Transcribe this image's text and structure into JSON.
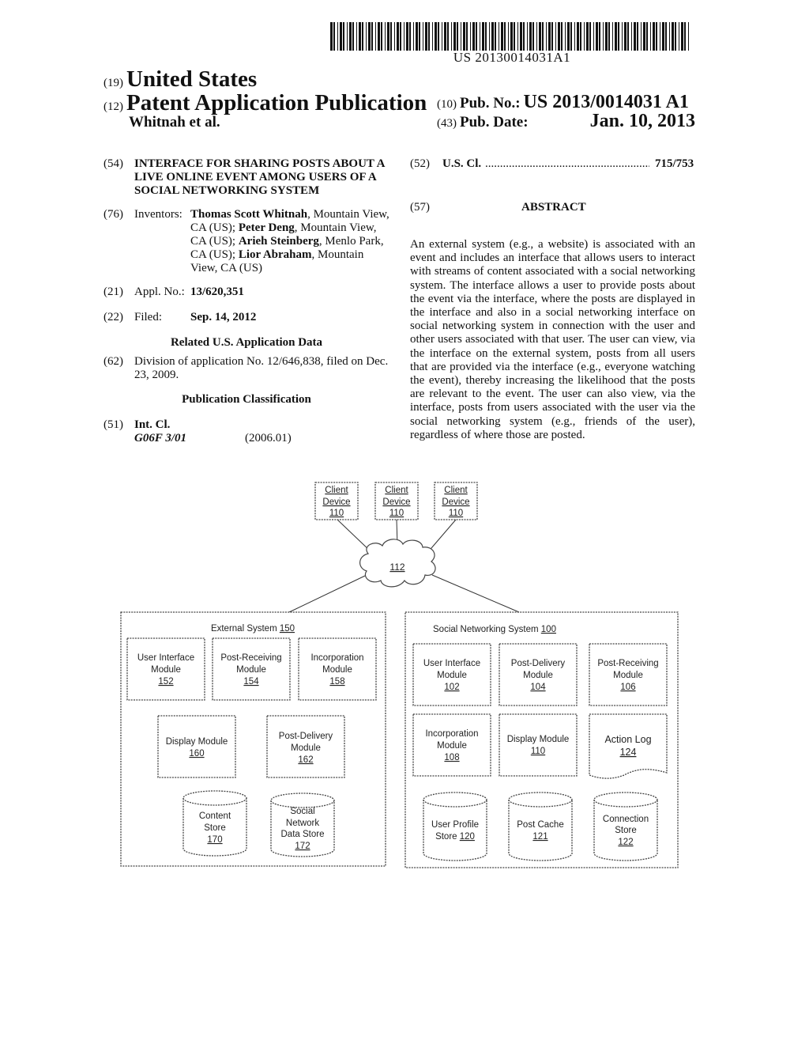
{
  "barcode": {
    "number": "US 20130014031A1"
  },
  "header": {
    "country_code": "(19)",
    "country": "United States",
    "type_code": "(12)",
    "type": "Patent Application Publication",
    "authors": "Whitnah et al.",
    "pub_no_code": "(10)",
    "pub_no_label": "Pub. No.:",
    "pub_no": "US 2013/0014031 A1",
    "pub_date_code": "(43)",
    "pub_date_label": "Pub. Date:",
    "pub_date": "Jan. 10, 2013"
  },
  "left": {
    "title_code": "(54)",
    "title_lines": [
      "INTERFACE FOR SHARING POSTS ABOUT A",
      "LIVE ONLINE EVENT AMONG USERS OF A",
      "SOCIAL NETWORKING SYSTEM"
    ],
    "inventors_code": "(76)",
    "inventors_label": "Inventors:",
    "inventors": [
      {
        "name": "Thomas Scott Whitnah",
        "loc": ", Mountain View, CA (US); "
      },
      {
        "name": "Peter Deng",
        "loc": ", Mountain View, CA (US); "
      },
      {
        "name": "Arieh Steinberg",
        "loc": ", Menlo Park, CA (US); "
      },
      {
        "name": "Lior Abraham",
        "loc": ", Mountain View, CA (US)"
      }
    ],
    "appl_code": "(21)",
    "appl_label": "Appl. No.:",
    "appl_no": "13/620,351",
    "filed_code": "(22)",
    "filed_label": "Filed:",
    "filed_date": "Sep. 14, 2012",
    "related_heading": "Related U.S. Application Data",
    "division_code": "(62)",
    "division_line1": "Division of application No. 12/646,838, filed on Dec.",
    "division_line2": "23, 2009.",
    "classification_heading": "Publication Classification",
    "intcl_code": "(51)",
    "intcl_label": "Int. Cl.",
    "intcl_class": "G06F 3/01",
    "intcl_version": "(2006.01)"
  },
  "right": {
    "uscl_code": "(52)",
    "uscl_label": "U.S. Cl.",
    "uscl_dots": "........................................................",
    "uscl_value": "715/753",
    "abstract_code": "(57)",
    "abstract_heading": "ABSTRACT",
    "abstract_text": "An external system (e.g., a website) is associated with an event and includes an interface that allows users to interact with streams of content associated with a social networking system. The interface allows a user to provide posts about the event via the interface, where the posts are displayed in the interface and also in a social networking interface on social networking system in connection with the user and other users associated with that user. The user can view, via the interface on the external system, posts from all users that are provided via the interface (e.g., everyone watching the event), thereby increasing the likelihood that the posts are relevant to the event. The user can also view, via the interface, posts from users associated with the user via the social networking sys­tem (e.g., friends of the user), regardless of where those are posted."
  },
  "diagram": {
    "clients": [
      {
        "l1": "Client",
        "l2": "Device",
        "ref": "110"
      },
      {
        "l1": "Client",
        "l2": "Device",
        "ref": "110"
      },
      {
        "l1": "Client",
        "l2": "Device",
        "ref": "110"
      }
    ],
    "network_ref": "112",
    "external": {
      "title": "External System ",
      "ref": "150",
      "modules": [
        {
          "l1": "User Interface",
          "l2": "Module",
          "ref": "152"
        },
        {
          "l1": "Post-Receiving",
          "l2": "Module",
          "ref": "154"
        },
        {
          "l1": "Incorporation",
          "l2": "Module",
          "ref": "158"
        },
        {
          "l1": "Display Module",
          "ref": "160"
        },
        {
          "l1": "Post-Delivery",
          "l2": "Module",
          "ref": "162"
        }
      ],
      "stores": [
        {
          "l1": "Content",
          "l2": "Store",
          "ref": "170"
        },
        {
          "l1": "Social",
          "l2": "Network",
          "l3": "Data Store",
          "ref": "172"
        }
      ]
    },
    "social": {
      "title": "Social Networking System ",
      "ref": "100",
      "modules": [
        {
          "l1": "User Interface",
          "l2": "Module",
          "ref": "102"
        },
        {
          "l1": "Post-Delivery",
          "l2": "Module",
          "ref": "104"
        },
        {
          "l1": "Post-Receiving",
          "l2": "Module",
          "ref": "106"
        },
        {
          "l1": "Incorporation",
          "l2": "Module",
          "ref": "108"
        },
        {
          "l1": "Display Module",
          "ref": "110"
        },
        {
          "l1": "Action Log",
          "ref": "124"
        }
      ],
      "stores": [
        {
          "l1": "User Profile",
          "l2": "Store ",
          "ref": "120"
        },
        {
          "l1": "Post Cache",
          "ref": "121"
        },
        {
          "l1": "Connection",
          "l2": "Store",
          "ref": "122"
        }
      ]
    }
  }
}
